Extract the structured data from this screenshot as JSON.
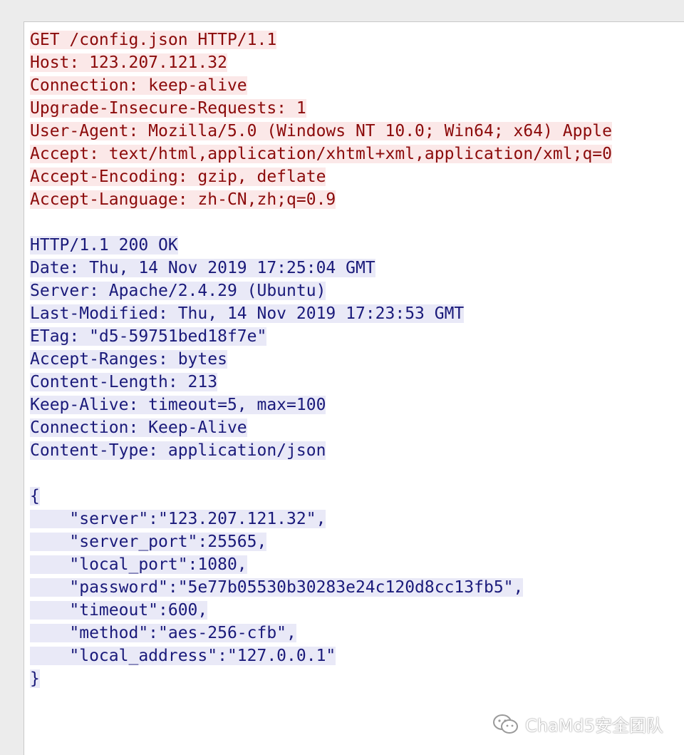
{
  "request": {
    "lines": [
      "GET /config.json HTTP/1.1",
      "Host: 123.207.121.32",
      "Connection: keep-alive",
      "Upgrade-Insecure-Requests: 1",
      "User-Agent: Mozilla/5.0 (Windows NT 10.0; Win64; x64) Apple",
      "Accept: text/html,application/xhtml+xml,application/xml;q=0",
      "Accept-Encoding: gzip, deflate",
      "Accept-Language: zh-CN,zh;q=0.9"
    ]
  },
  "response": {
    "status_line": "HTTP/1.1 200 OK",
    "headers": [
      "Date: Thu, 14 Nov 2019 17:25:04 GMT",
      "Server: Apache/2.4.29 (Ubuntu)",
      "Last-Modified: Thu, 14 Nov 2019 17:23:53 GMT",
      "ETag: \"d5-59751bed18f7e\"",
      "Accept-Ranges: bytes",
      "Content-Length: 213",
      "Keep-Alive: timeout=5, max=100",
      "Connection: Keep-Alive",
      "Content-Type: application/json"
    ],
    "body_lines": [
      "{",
      "    \"server\":\"123.207.121.32\",",
      "    \"server_port\":25565,",
      "    \"local_port\":1080,",
      "    \"password\":\"5e77b05530b30283e24c120d8cc13fb5\",",
      "    \"timeout\":600,",
      "    \"method\":\"aes-256-cfb\",",
      "    \"local_address\":\"127.0.0.1\"",
      "}"
    ]
  },
  "watermark": {
    "text": "ChaMd5安全团队",
    "icon": "wechat-icon"
  }
}
